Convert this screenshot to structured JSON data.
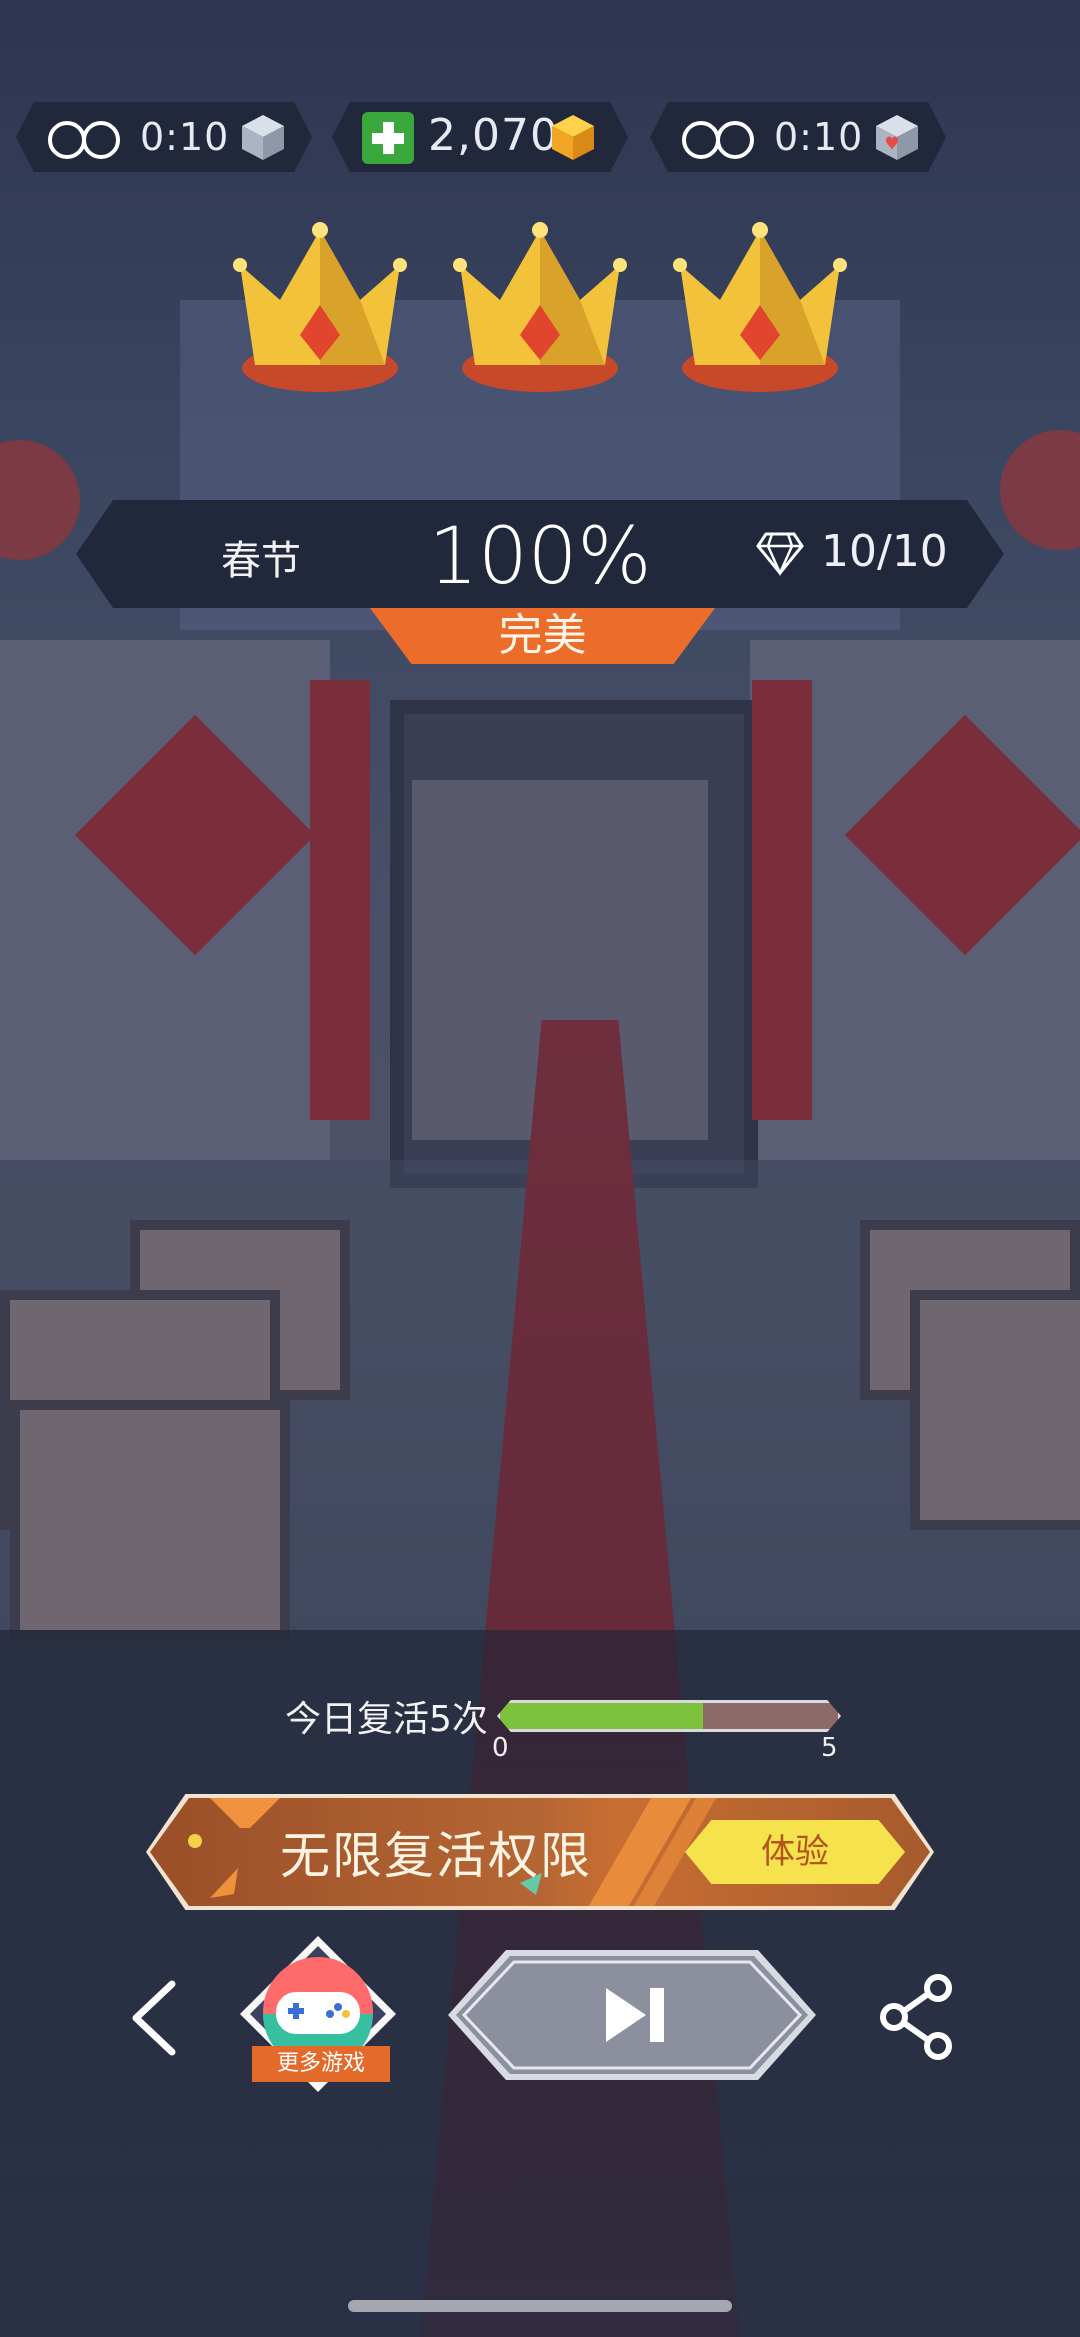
{
  "resources": [
    {
      "icon": "infinity-icon",
      "value": "0:10",
      "item_icon": "cube-icon"
    },
    {
      "icon": "plus-icon",
      "value": "2,070",
      "item_icon": "gold-cube-icon"
    },
    {
      "icon": "infinity-icon",
      "value": "0:10",
      "item_icon": "heart-cube-icon"
    }
  ],
  "crowns": {
    "earned": 3,
    "total": 3
  },
  "result": {
    "level_name": "春节",
    "percent": "100%",
    "gems": "10/10",
    "rating": "完美"
  },
  "revive": {
    "label_prefix": "今日复活",
    "count": "5",
    "label_suffix": "次",
    "min": "0",
    "max": "5",
    "progress_value": 3,
    "progress_max": 5
  },
  "vip": {
    "title": "无限复活权限",
    "button": "体验"
  },
  "nav": {
    "more_games": "更多游戏"
  },
  "colors": {
    "accent_orange": "#ec6d2a",
    "progress_green": "#7cc23d",
    "try_yellow": "#f5e24c"
  }
}
